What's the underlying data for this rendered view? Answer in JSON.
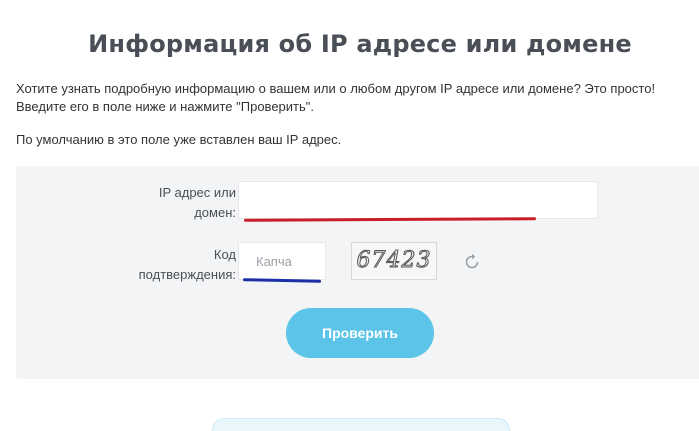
{
  "header": {
    "title": "Информация об IP адресе или домене"
  },
  "intro": {
    "line1": "Хотите узнать подробную информацию о вашем или о любом другом IP адресе или домене? Это просто!",
    "line2": "Введите его в поле ниже и нажмите \"Проверить\".",
    "note": "По умолчанию в это поле уже вставлен ваш IP адрес."
  },
  "form": {
    "ip_label_line1": "IP адрес или",
    "ip_label_line2": "домен:",
    "ip_value": "",
    "code_label_line1": "Код",
    "code_label_line2": "подтверждения:",
    "captcha_placeholder": "Капча",
    "captcha_image_text": "67423",
    "refresh_icon": "refresh-icon",
    "submit_label": "Проверить"
  },
  "colors": {
    "title": "#4a4f57",
    "panel_bg": "#f3f4f6",
    "accent_button": "#5bc4e8",
    "ip_underline": "#c81e28",
    "captcha_underline": "#1a2fa8"
  }
}
